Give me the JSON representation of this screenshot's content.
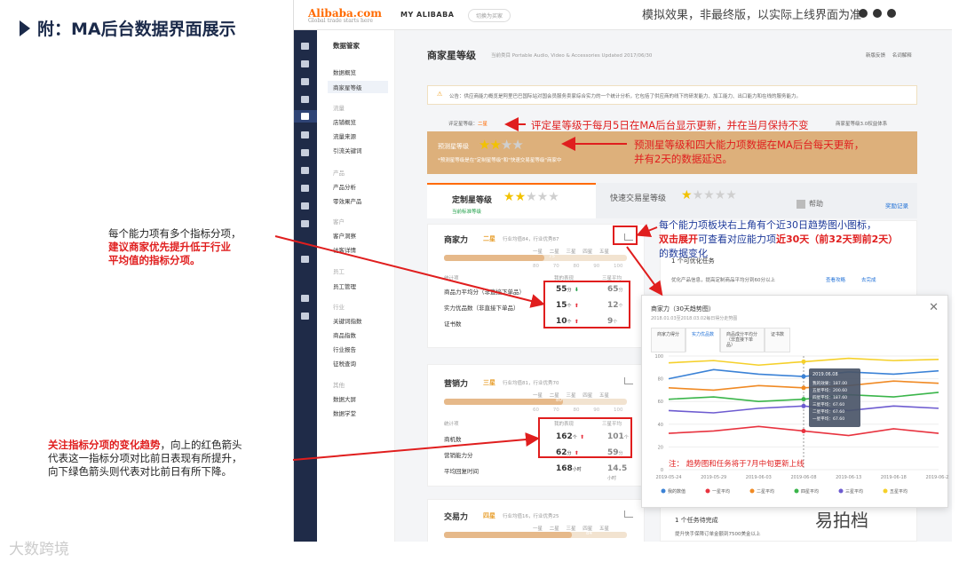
{
  "slide": {
    "title": "附：MA后台数据界面展示",
    "watermark_left": "大数跨境",
    "watermark_right": "易拍档"
  },
  "topbar": {
    "logo": "Alibaba.com",
    "logo_tag": "Global trade starts here",
    "my_alibaba": "MY ALIBABA",
    "switch_button": "切换为买家",
    "demo_notice": "模拟效果，非最终版，以实际上线界面为准"
  },
  "nav": {
    "title": "数据管家",
    "items": [
      {
        "label": "数据概览",
        "group": false
      },
      {
        "label": "商家星等级",
        "group": false,
        "active": true
      },
      {
        "label": "流量",
        "group": true
      },
      {
        "label": "店铺概览",
        "group": false
      },
      {
        "label": "流量来源",
        "group": false
      },
      {
        "label": "引流关键词",
        "group": false
      },
      {
        "label": "产品",
        "group": true
      },
      {
        "label": "产品分析",
        "group": false
      },
      {
        "label": "零效果产品",
        "group": false
      },
      {
        "label": "客户",
        "group": true
      },
      {
        "label": "客户洞察",
        "group": false
      },
      {
        "label": "访客详情",
        "group": false
      },
      {
        "label": "员工",
        "group": true
      },
      {
        "label": "员工管理",
        "group": false
      },
      {
        "label": "行业",
        "group": true
      },
      {
        "label": "关键词指数",
        "group": false
      },
      {
        "label": "商品指数",
        "group": false
      },
      {
        "label": "行业报告",
        "group": false
      },
      {
        "label": "征税查询",
        "group": false
      },
      {
        "label": "其他",
        "group": true
      },
      {
        "label": "数据大屏",
        "group": false
      },
      {
        "label": "数据学堂",
        "group": false
      }
    ]
  },
  "page": {
    "title": "商家星等级",
    "subtitle": "当前类目 Portable Audio, Video & Accessories   Updated 2017/06/30",
    "links": "新版反馈 名词解释",
    "notice": "公告：供应商能力概览是阿里巴巴国际站对国会员服务卖家综合实力的一个统计分析，它包括了供应商的线下的研发能力、加工能力、出口能力和在线的服务能力。",
    "rating_label": "评定星等级：",
    "rating_value": "二星",
    "right_note": "商家星等级3.0权益体系",
    "predict_label": "预测星等级",
    "predict_stars": 2,
    "predict_caption": "*预测星等级是在\"定制星等级\"和\"快速交易星等级\"商家中"
  },
  "tabs": {
    "tab1_label": "定制星等级",
    "tab1_stars": 2,
    "tab1_sub": "当前标准等级",
    "tab2_label": "快速交易星等级",
    "tab2_stars": 1,
    "help": "帮助",
    "reward": "奖励记录"
  },
  "cards": [
    {
      "title": "商家力",
      "level": "二星",
      "avg": "行业均值84，行业优秀87",
      "levels": "一星 二星 三星 四星 五星",
      "bar_value": "75",
      "ticks": "80 70 80 90 100",
      "head_mine": "我的表现",
      "head_avg": "三星平均",
      "head_stat": "统计项",
      "rows": [
        {
          "label": "商品力平均分（非直接下单品）",
          "mine": "55",
          "mine_unit": "分",
          "trend": "down",
          "avg": "65",
          "avg_unit": "分"
        },
        {
          "label": "实力优品数（非直接下单品）",
          "mine": "15",
          "mine_unit": "个",
          "trend": "up",
          "avg": "12",
          "avg_unit": "个"
        },
        {
          "label": "证书数",
          "mine": "10",
          "mine_unit": "个",
          "trend": "up",
          "avg": "9",
          "avg_unit": "个"
        }
      ]
    },
    {
      "title": "营销力",
      "level": "三星",
      "avg": "行业均值81，行业优秀70",
      "levels": "一星 二星 三星 四星 五星",
      "bar_value": "80",
      "ticks": "60 70 80 90 100",
      "head_mine": "我的表现",
      "head_avg": "三星平均",
      "head_stat": "统计项",
      "rows": [
        {
          "label": "商机数",
          "mine": "162",
          "mine_unit": "个",
          "trend": "up",
          "avg": "101",
          "avg_unit": "个"
        },
        {
          "label": "营销能力分",
          "mine": "62",
          "mine_unit": "分",
          "trend": "up",
          "avg": "59",
          "avg_unit": "分"
        },
        {
          "label": "平均回复时间",
          "mine": "168",
          "mine_unit": "小时",
          "trend": "",
          "avg": "14.5",
          "avg_unit": "小时"
        }
      ]
    },
    {
      "title": "交易力",
      "level": "四星",
      "avg": "行业均值16，行业优秀25",
      "levels": "一星 二星 三星 四星 五星",
      "bar_value": "84"
    }
  ],
  "task_panel": {
    "title": "1 个可优化任务",
    "task": "优化产品信息，提高定制商品平均分到60分以上",
    "link1": "查看攻略",
    "link2": "去完成"
  },
  "task_panel2": {
    "title": "1 个任务待完成",
    "task": "提升快手保障订单金额到7500美金以上"
  },
  "modal": {
    "title": "商家力（30天趋势图）",
    "subtitle": "2018.01.03至2018.03.02每日得分走势图",
    "tabs": [
      "商家力得分",
      "实力优品数",
      "商品成分平均分（非直接下单品）",
      "证书数"
    ],
    "active_tab": 1,
    "tooltip_date": "2019.06.08",
    "tooltip_rows": [
      "我的效果：187.00",
      "五星平均：200.60",
      "四星平均：187.60",
      "三星平均：67.60",
      "二星平均：67.60",
      "一星平均：67.60"
    ],
    "note": "注： 趋势图和任务将于7月中旬更新上线"
  },
  "chart_data": {
    "type": "line",
    "x": [
      "2019-05-24",
      "2019-05-29",
      "2019-06-03",
      "2019-06-08",
      "2019-06-13",
      "2019-06-18",
      "2019-06-23"
    ],
    "ylim": [
      0,
      100
    ],
    "yticks": [
      0,
      20,
      40,
      60,
      80,
      100
    ],
    "series": [
      {
        "name": "我的数值",
        "color": "#3b82d6",
        "values": [
          80,
          88,
          84,
          82,
          86,
          84,
          87
        ]
      },
      {
        "name": "一星平均",
        "color": "#e8333f",
        "values": [
          32,
          34,
          38,
          34,
          30,
          36,
          32
        ]
      },
      {
        "name": "二星平均",
        "color": "#f08a24",
        "values": [
          72,
          70,
          74,
          72,
          74,
          78,
          76
        ]
      },
      {
        "name": "四星平均",
        "color": "#3ab54a",
        "values": [
          62,
          64,
          60,
          62,
          66,
          64,
          68
        ]
      },
      {
        "name": "三星平均",
        "color": "#6d5bd0",
        "values": [
          52,
          50,
          54,
          56,
          52,
          56,
          54
        ]
      },
      {
        "name": "五星平均",
        "color": "#f5d02a",
        "values": [
          94,
          96,
          92,
          95,
          98,
          96,
          97
        ]
      }
    ]
  },
  "annotations": {
    "a1": "评定星等级于每月5日在MA后台显示更新，并在当月保持不变",
    "a2": "预测星等级和四大能力项数据在MA后台每天更新，",
    "a2b": "并有2天的数据延迟。",
    "a3_1": "每个能力项板块右上角有个近30日趋势图小图标，",
    "a3_2a": "双击展开",
    "a3_2b": "可查看对应能力项",
    "a3_2c": "近30天（前32天到前2天）",
    "a3_3": "的数据变化",
    "left1_1": "每个能力项有多个指标分项，",
    "left1_2": "建议商家优先提升低于行业",
    "left1_3": "平均值的指标分项。",
    "left2_b": "关注指标分项的变化趋势",
    "left2_1": "，向上的红色箭头",
    "left2_2": "代表这一指标分项对比前日表现有所提升，",
    "left2_3": "向下绿色箭头则代表对比前日有所下降。"
  }
}
